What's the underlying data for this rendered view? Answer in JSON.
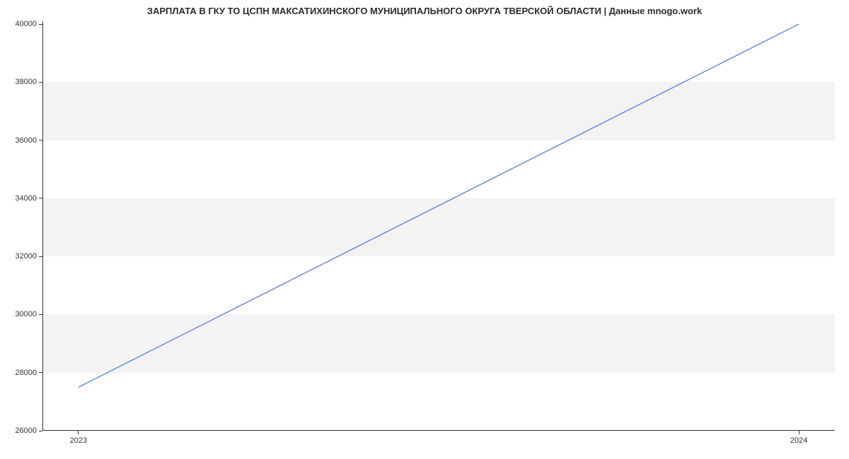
{
  "chart_data": {
    "type": "line",
    "title": "ЗАРПЛАТА В ГКУ ТО ЦСПН МАКСАТИХИНСКОГО МУНИЦИПАЛЬНОГО ОКРУГА ТВЕРСКОЙ ОБЛАСТИ | Данные mnogo.work",
    "xlabel": "",
    "ylabel": "",
    "x": [
      2023,
      2024
    ],
    "values": [
      27500,
      40000
    ],
    "x_ticks": [
      2023,
      2024
    ],
    "y_ticks": [
      26000,
      28000,
      30000,
      32000,
      34000,
      36000,
      38000,
      40000
    ],
    "ylim": [
      26000,
      40100
    ],
    "xlim": [
      2022.95,
      2024.05
    ],
    "line_color": "#6a8fd8",
    "band_color": "#f3f3f3"
  }
}
